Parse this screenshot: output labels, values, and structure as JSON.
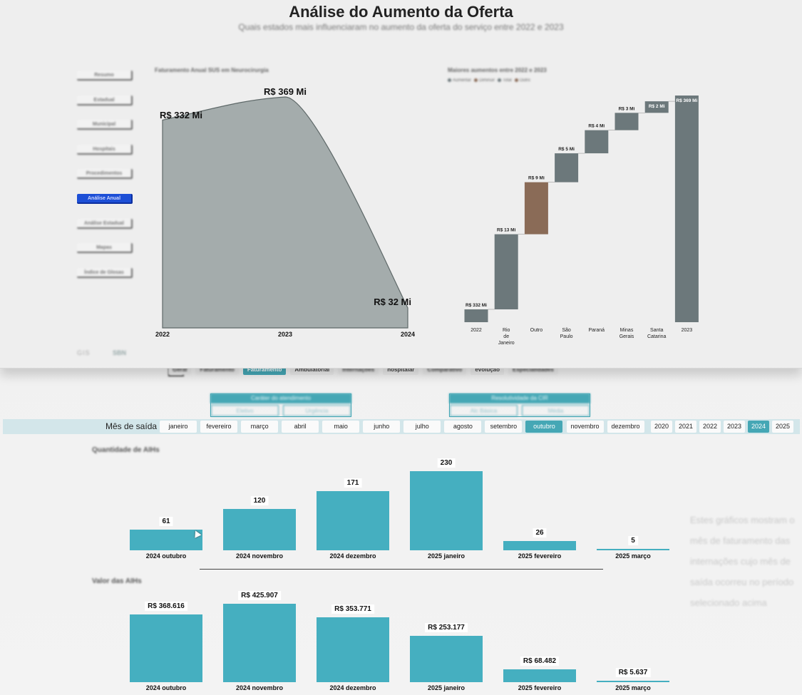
{
  "panel": {
    "title": "Análise do Aumento da Oferta",
    "subtitle": "Quais estados mais influenciaram no aumento da oferta do serviço entre 2022 e 2023",
    "nav": [
      {
        "label": "Resumo",
        "active": false
      },
      {
        "label": "Estadual",
        "active": false
      },
      {
        "label": "Municipal",
        "active": false
      },
      {
        "label": "Hospitais",
        "active": false
      },
      {
        "label": "Procedimentos",
        "active": false
      },
      {
        "label": "Análise Anual",
        "active": true
      },
      {
        "label": "Análise Estadual",
        "active": false
      },
      {
        "label": "Mapas",
        "active": false
      },
      {
        "label": "Índice de Glosas",
        "active": false
      }
    ],
    "logos": {
      "left": "GIS",
      "right": "SBN"
    }
  },
  "chart_data": [
    {
      "type": "area",
      "title": "Faturamento Anual SUS em Neurocirurgia",
      "categories": [
        "2022",
        "2023",
        "2024"
      ],
      "values": [
        332,
        369,
        32
      ],
      "data_labels": [
        "R$ 332 Mi",
        "R$ 369 Mi",
        "R$ 32 Mi"
      ],
      "color": "#a4acac"
    },
    {
      "type": "waterfall",
      "title": "Maiores aumentos entre 2022 e 2023",
      "legend": [
        {
          "label": "Aumentar",
          "color": "#6c787b"
        },
        {
          "label": "Diminuir",
          "color": "#8a6b57"
        },
        {
          "label": "Total",
          "color": "#6c787b"
        },
        {
          "label": "Outro",
          "color": "#8a6b57"
        }
      ],
      "categories": [
        "2022",
        "Rio de Janeiro",
        "Outro",
        "São Paulo",
        "Paraná",
        "Minas Gerais",
        "Santa Catarina",
        "2023"
      ],
      "values": [
        332,
        13,
        9,
        5,
        4,
        3,
        2,
        369
      ],
      "kinds": [
        "total",
        "increase",
        "other",
        "increase",
        "increase",
        "increase",
        "increase",
        "total"
      ],
      "data_labels": [
        "R$ 332 Mi",
        "R$ 13 Mi",
        "R$ 9 Mi",
        "R$ 5 Mi",
        "R$ 4 Mi",
        "R$ 3 Mi",
        "R$ 2 Mi",
        "R$ 369 Mi"
      ]
    },
    {
      "type": "bar",
      "title": "Quantidade de AIHs",
      "categories": [
        "2024 outubro",
        "2024 novembro",
        "2024 dezembro",
        "2025 janeiro",
        "2025 fevereiro",
        "2025 março"
      ],
      "values": [
        61,
        120,
        171,
        230,
        26,
        5
      ],
      "data_labels": [
        "61",
        "120",
        "171",
        "230",
        "26",
        "5"
      ],
      "color": "#45afc0"
    },
    {
      "type": "bar",
      "title": "Valor das AIHs",
      "categories": [
        "2024 outubro",
        "2024 novembro",
        "2024 dezembro",
        "2025 janeiro",
        "2025 fevereiro",
        "2025 março"
      ],
      "values": [
        368616,
        425907,
        353771,
        253177,
        68482,
        5637
      ],
      "data_labels": [
        "R$ 368.616",
        "R$ 425.907",
        "R$ 353.771",
        "R$ 253.177",
        "R$ 68.482",
        "R$ 5.637"
      ],
      "color": "#45afc0"
    }
  ],
  "back": {
    "nav_tabs": [
      {
        "label": "Geral",
        "selected": false
      },
      {
        "label": "Faturamento",
        "selected": false
      },
      {
        "label": "Faturamento",
        "selected": true
      },
      {
        "label": "Ambulatorial",
        "selected": false
      },
      {
        "label": "Internações",
        "selected": false
      },
      {
        "label": "hospitalar",
        "selected": false
      },
      {
        "label": "Comparativo",
        "selected": false
      },
      {
        "label": "evolução",
        "selected": false
      },
      {
        "label": "Especialidades",
        "selected": false
      }
    ],
    "filters": [
      {
        "header": "Caráter do atendimento",
        "options": [
          "Eletivo",
          "Urgência"
        ]
      },
      {
        "header": "Resolutividade da CIR",
        "options": [
          "Alc Básica",
          "Média"
        ]
      }
    ],
    "month_label": "Mês de saída",
    "months": [
      {
        "label": "janeiro",
        "selected": false
      },
      {
        "label": "fevereiro",
        "selected": false
      },
      {
        "label": "março",
        "selected": false
      },
      {
        "label": "abril",
        "selected": false
      },
      {
        "label": "maio",
        "selected": false
      },
      {
        "label": "junho",
        "selected": false
      },
      {
        "label": "julho",
        "selected": false
      },
      {
        "label": "agosto",
        "selected": false
      },
      {
        "label": "setembro",
        "selected": false
      },
      {
        "label": "outubro",
        "selected": true
      },
      {
        "label": "novembro",
        "selected": false
      },
      {
        "label": "dezembro",
        "selected": false
      }
    ],
    "years": [
      {
        "label": "2020",
        "selected": false
      },
      {
        "label": "2021",
        "selected": false
      },
      {
        "label": "2022",
        "selected": false
      },
      {
        "label": "2023",
        "selected": false
      },
      {
        "label": "2024",
        "selected": true
      },
      {
        "label": "2025",
        "selected": false
      }
    ],
    "side_note": "Estes gráficos mostram o mês de faturamento das internações cujo mês de saída ocorreu no período selecionado acima"
  }
}
